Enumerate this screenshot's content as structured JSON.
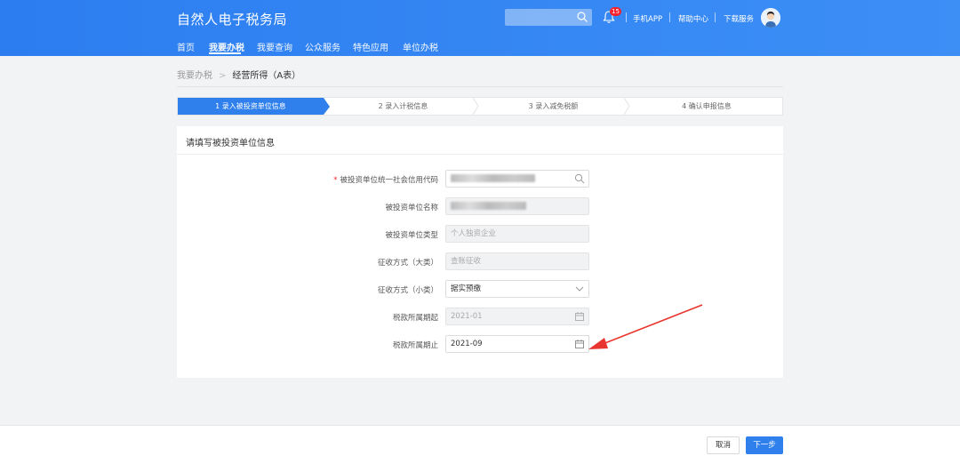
{
  "header": {
    "app_title": "自然人电子税务局",
    "search_placeholder": "",
    "notification_count": "15",
    "links": [
      "手机APP",
      "帮助中心",
      "下载服务"
    ]
  },
  "nav": {
    "items": [
      "首页",
      "我要办税",
      "我要查询",
      "公众服务",
      "特色应用",
      "单位办税"
    ],
    "active": "我要办税"
  },
  "breadcrumb": {
    "parent": "我要办税",
    "current": "经营所得（A表）"
  },
  "steps": [
    {
      "label": "1 录入被投资单位信息",
      "active": true
    },
    {
      "label": "2 录入计税信息",
      "active": false
    },
    {
      "label": "3 录入减免税额",
      "active": false
    },
    {
      "label": "4 确认申报信息",
      "active": false
    }
  ],
  "panel": {
    "title": "请填写被投资单位信息"
  },
  "form": {
    "credit_code": {
      "label": "被投资单位统一社会信用代码",
      "required_mark": "*",
      "value": ""
    },
    "unit_name": {
      "label": "被投资单位名称",
      "value": ""
    },
    "unit_type": {
      "label": "被投资单位类型",
      "value": "个人独资企业"
    },
    "levy_major": {
      "label": "征收方式（大类）",
      "value": "查账征收"
    },
    "levy_minor": {
      "label": "征收方式（小类）",
      "value": "据实预缴"
    },
    "period_start": {
      "label": "税款所属期起",
      "value": "2021-01"
    },
    "period_end": {
      "label": "税款所属期止",
      "value": "2021-09"
    }
  },
  "footer": {
    "cancel_label": "取消",
    "next_label": "下一步"
  },
  "colors": {
    "primary": "#2f80ed",
    "header": "#2c7df0",
    "annotation_arrow": "#e8352f"
  }
}
